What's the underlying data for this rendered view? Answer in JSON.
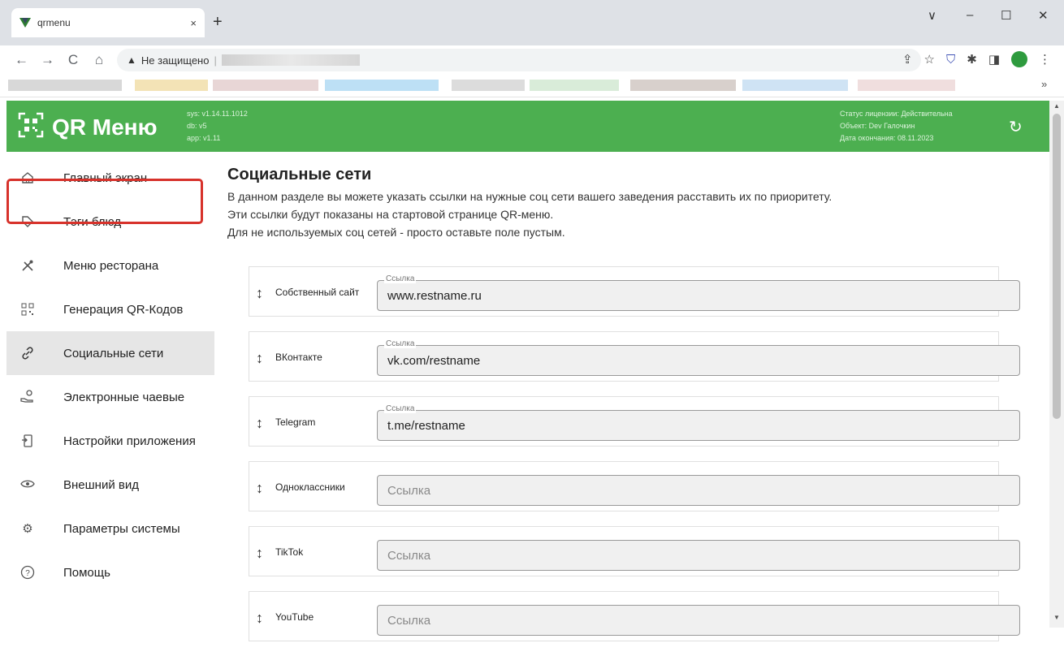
{
  "browser": {
    "tab_title": "qrmenu",
    "tab_close": "×",
    "new_tab": "+",
    "security_label": "Не защищено",
    "nav": {
      "back": "←",
      "forward": "→",
      "reload": "C",
      "home": "⌂"
    },
    "win": {
      "minimize": "–",
      "maximize": "☐",
      "close": "✕",
      "menu": "∨"
    },
    "more": "»"
  },
  "header": {
    "logo_text": "QR Меню",
    "versions": [
      "sys: v1.14.11.1012",
      "db: v5",
      "app: v1.11"
    ],
    "license": [
      "Статус лицензии: Действительна",
      "Объект: Dev Галочкин",
      "Дата окончания: 08.11.2023"
    ],
    "refresh_icon": "↻"
  },
  "sidebar": {
    "items": [
      {
        "label": "Главный экран",
        "icon": "home-icon"
      },
      {
        "label": "Тэги блюд",
        "icon": "tag-icon"
      },
      {
        "label": "Меню ресторана",
        "icon": "utensils-icon"
      },
      {
        "label": "Генерация QR-Кодов",
        "icon": "qr-icon"
      },
      {
        "label": "Социальные сети",
        "icon": "link-icon",
        "active": true
      },
      {
        "label": "Электронные чаевые",
        "icon": "tips-icon"
      },
      {
        "label": "Настройки приложения",
        "icon": "phone-settings-icon"
      },
      {
        "label": "Внешний вид",
        "icon": "eye-icon"
      },
      {
        "label": "Параметры системы",
        "icon": "gear-icon"
      },
      {
        "label": "Помощь",
        "icon": "help-icon"
      }
    ]
  },
  "main": {
    "title": "Социальные сети",
    "description": [
      "В данном разделе вы можете указать ссылки на нужные соц сети вашего заведения расставить их по приоритету.",
      "Эти ссылки будут показаны на стартовой странице QR-меню.",
      "Для не используемых соц сетей - просто оставьте поле пустым."
    ],
    "field_label": "Ссылка",
    "drag_icon": "↕",
    "socials": [
      {
        "name": "Собственный сайт",
        "value": "www.restname.ru"
      },
      {
        "name": "ВКонтакте",
        "value": "vk.com/restname"
      },
      {
        "name": "Telegram",
        "value": "t.me/restname"
      },
      {
        "name": "Одноклассники",
        "value": ""
      },
      {
        "name": "TikTok",
        "value": ""
      },
      {
        "name": "YouTube",
        "value": ""
      }
    ]
  },
  "colors": {
    "brand": "#4caf50",
    "highlight": "#d7322b"
  }
}
